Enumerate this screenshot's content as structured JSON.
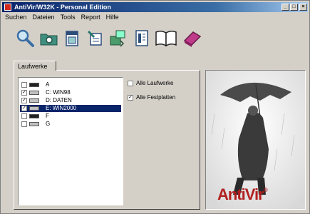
{
  "window": {
    "title": "AntiVir/W32K - Personal Edition"
  },
  "menu": [
    "Suchen",
    "Dateien",
    "Tools",
    "Report",
    "Hilfe"
  ],
  "toolbar_icons": [
    "search-icon",
    "scan-folder-icon",
    "calendar-icon",
    "configure-icon",
    "update-icon",
    "report-icon",
    "book-icon",
    "eraser-icon"
  ],
  "tabs": {
    "active": "Laufwerke"
  },
  "drives": [
    {
      "label": "A",
      "checked": false,
      "selected": false,
      "type": "floppy"
    },
    {
      "label": "C: WIN98",
      "checked": true,
      "selected": false,
      "type": "hdd"
    },
    {
      "label": "D: DATEN",
      "checked": true,
      "selected": false,
      "type": "hdd"
    },
    {
      "label": "E: WIN2000",
      "checked": true,
      "selected": true,
      "type": "hdd"
    },
    {
      "label": "F",
      "checked": false,
      "selected": false,
      "type": "floppy"
    },
    {
      "label": "G",
      "checked": false,
      "selected": false,
      "type": "cdrom"
    }
  ],
  "options": {
    "all_drives": {
      "label": "Alle Laufwerke",
      "checked": false
    },
    "all_hard_drives": {
      "label": "Alle Festplatten",
      "checked": true
    }
  },
  "brand": {
    "name": "AntiVir",
    "mark": "®",
    "color": "#b21f1f"
  }
}
